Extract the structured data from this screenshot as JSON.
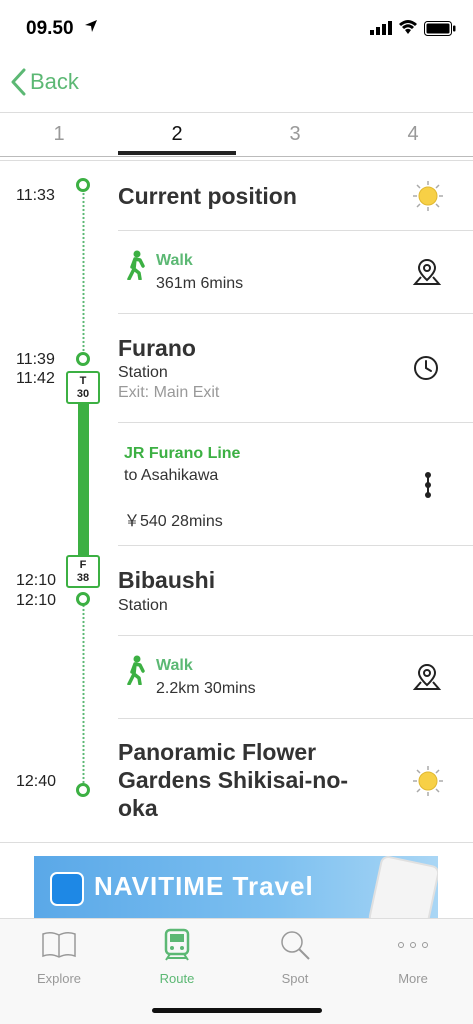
{
  "status": {
    "time": "09.50"
  },
  "nav": {
    "back_label": "Back"
  },
  "steps": [
    "1",
    "2",
    "3",
    "4"
  ],
  "route": {
    "origin": {
      "time": "11:33",
      "title": "Current position",
      "icon": "sun-icon"
    },
    "walk1": {
      "label": "Walk",
      "detail": "361m  6mins",
      "icon": "map-pin-icon"
    },
    "furano": {
      "time_arr": "11:39",
      "time_dep": "11:42",
      "title": "Furano",
      "subtitle": "Station",
      "exit": "Exit: Main Exit",
      "badge_line": "T",
      "badge_num": "30",
      "icon": "clock-icon"
    },
    "train": {
      "line": "JR Furano Line",
      "to": "to Asahikawa",
      "fare": "￥540  28mins",
      "icon": "stops-icon"
    },
    "bibaushi": {
      "time_arr": "12:10",
      "time_dep": "12:10",
      "title": "Bibaushi",
      "subtitle": "Station",
      "badge_line": "F",
      "badge_num": "38"
    },
    "walk2": {
      "label": "Walk",
      "detail": "2.2km  30mins",
      "icon": "map-pin-icon"
    },
    "dest": {
      "time": "12:40",
      "title_line1": "Panoramic Flower",
      "title_line2": "Gardens Shikisai-no-",
      "title_line3": "oka",
      "icon": "sun-icon"
    }
  },
  "banner": {
    "text": "NAVITIME  Travel"
  },
  "tabbar": [
    {
      "label": "Explore",
      "icon": "book-icon"
    },
    {
      "label": "Route",
      "icon": "train-icon"
    },
    {
      "label": "Spot",
      "icon": "search-icon"
    },
    {
      "label": "More",
      "icon": "more-icon"
    }
  ],
  "colors": {
    "accent": "#5cb874",
    "line": "#3cb043",
    "sun": "#f7d046"
  }
}
